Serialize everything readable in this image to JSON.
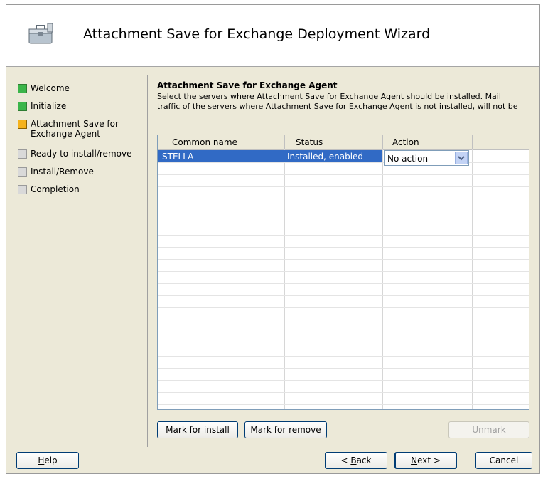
{
  "window": {
    "title": "Attachment Save for Exchange Deployment Wizard"
  },
  "steps": [
    {
      "label": "Welcome",
      "state": "done"
    },
    {
      "label": "Initialize",
      "state": "done"
    },
    {
      "label": "Attachment Save for\nExchange Agent",
      "state": "current"
    },
    {
      "label": "Ready to install/remove",
      "state": "pending"
    },
    {
      "label": "Install/Remove",
      "state": "pending"
    },
    {
      "label": "Completion",
      "state": "pending"
    }
  ],
  "section": {
    "title": "Attachment Save for Exchange Agent",
    "desc_line1": "Select the servers  where Attachment Save for Exchange Agent should be installed. Mail",
    "desc_line2": "traffic of the servers where Attachment Save for Exchange Agent is not installed, will not be"
  },
  "grid": {
    "columns": [
      "Common name",
      "Status",
      "Action"
    ],
    "rows": [
      {
        "name": "STELLA",
        "status": "Installed, enabled",
        "action": "No action"
      }
    ]
  },
  "buttons": {
    "mark_install": "Mark for install",
    "mark_remove": "Mark for remove",
    "unmark": "Unmark",
    "help_u": "H",
    "help_rest": "elp",
    "back_pre": "< ",
    "back_u": "B",
    "back_rest": "ack",
    "next_u": "N",
    "next_rest": "ext >",
    "cancel": "Cancel"
  },
  "colors": {
    "selection": "#316ac5",
    "done": "#3bb54a",
    "current": "#f5b21b",
    "pending": "#d9d9d9"
  }
}
